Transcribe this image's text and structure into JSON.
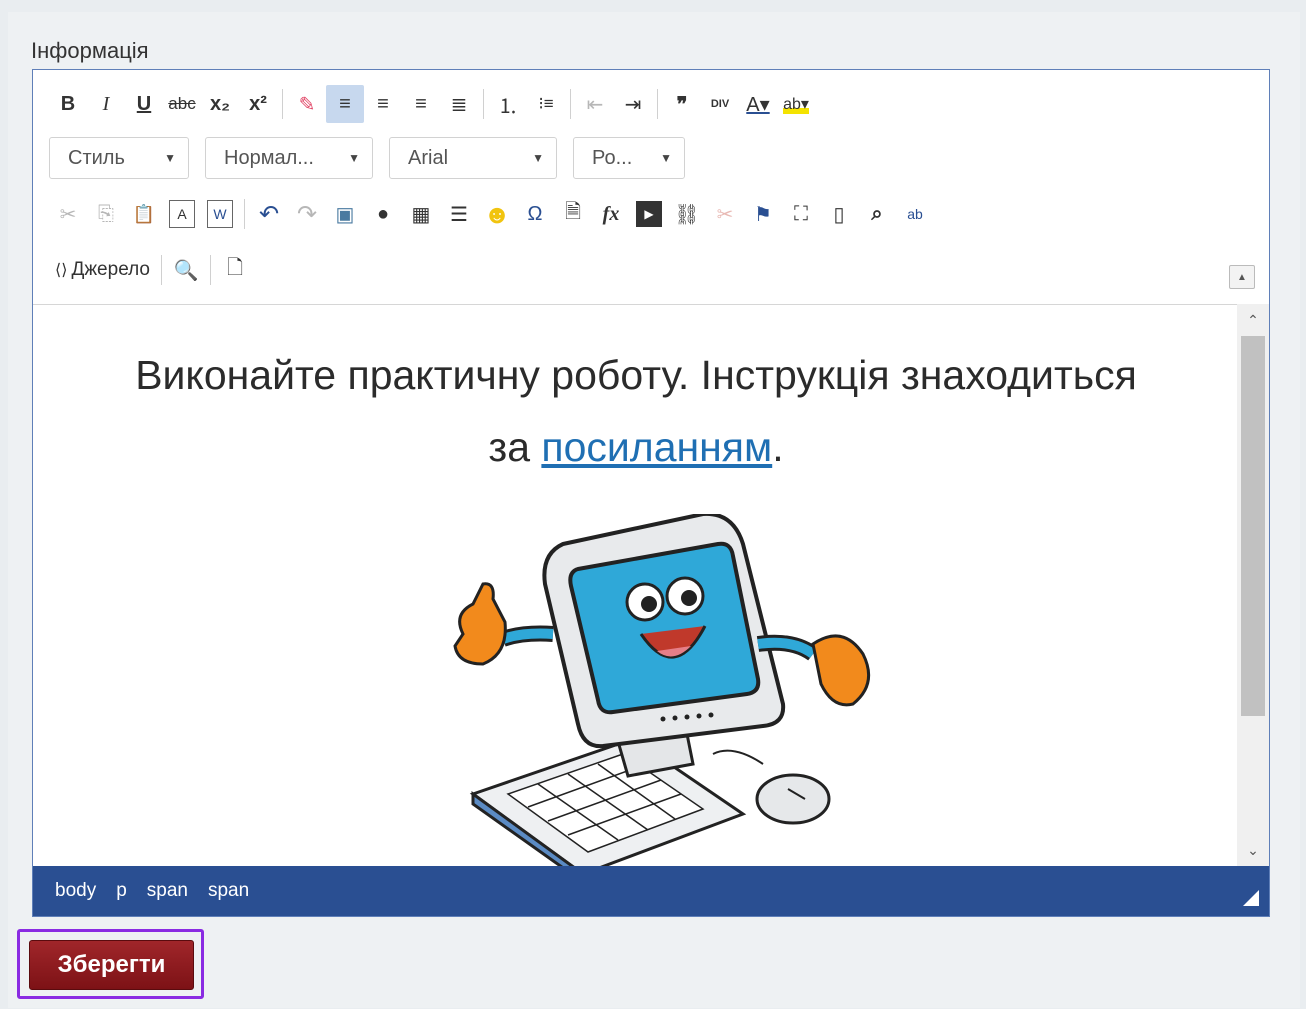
{
  "field": {
    "label": "Інформація"
  },
  "toolbar": {
    "row1": [
      {
        "name": "bold-button",
        "glyph": "B",
        "style": "font-weight:bold"
      },
      {
        "name": "italic-button",
        "glyph": "I",
        "style": "font-style:italic;font-family:'Liberation Serif',serif"
      },
      {
        "name": "underline-button",
        "glyph": "U",
        "style": "text-decoration:underline;font-weight:bold"
      },
      {
        "name": "strikethrough-button",
        "glyph": "abc",
        "style": "text-decoration:line-through;font-size:17px"
      },
      {
        "name": "subscript-button",
        "glyph": "x₂",
        "style": "font-weight:bold"
      },
      {
        "name": "superscript-button",
        "glyph": "x²",
        "style": "font-weight:bold"
      },
      {
        "sep": true
      },
      {
        "name": "remove-format-button",
        "glyph": "✎",
        "style": "color:#e24a6a"
      },
      {
        "name": "align-left-button",
        "glyph": "≡",
        "style": "",
        "active": true
      },
      {
        "name": "align-center-button",
        "glyph": "≡",
        "style": ""
      },
      {
        "name": "align-right-button",
        "glyph": "≡",
        "style": ""
      },
      {
        "name": "align-justify-button",
        "glyph": "≣",
        "style": ""
      },
      {
        "sep": true
      },
      {
        "name": "numbered-list-button",
        "glyph": "⒈",
        "style": ""
      },
      {
        "name": "bulleted-list-button",
        "glyph": "⁝≡",
        "style": "font-size:17px"
      },
      {
        "sep": true
      },
      {
        "name": "outdent-button",
        "glyph": "⇤",
        "style": "",
        "disabled": true
      },
      {
        "name": "indent-button",
        "glyph": "⇥",
        "style": ""
      },
      {
        "sep": true
      },
      {
        "name": "blockquote-button",
        "glyph": "❞",
        "style": "font-weight:bold"
      },
      {
        "name": "div-container-button",
        "glyph": "DIV",
        "style": "font-size:11px;font-weight:bold"
      },
      {
        "name": "text-color-button",
        "glyph": "A▾",
        "style": "text-decoration:underline;text-decoration-color:#2a4f92"
      },
      {
        "name": "background-color-button",
        "glyph": "ab▾",
        "style": "background:linear-gradient(transparent 70%,#f4e300 70%);font-size:16px"
      }
    ],
    "combos": [
      {
        "name": "style-combo",
        "label": "Стиль",
        "width": 140
      },
      {
        "name": "format-combo",
        "label": "Нормал...",
        "width": 168
      },
      {
        "name": "font-combo",
        "label": "Arial",
        "width": 168
      },
      {
        "name": "size-combo",
        "label": "Ро...",
        "width": 112
      }
    ],
    "row3": [
      {
        "name": "cut-button",
        "glyph": "✂",
        "style": "",
        "disabled": true
      },
      {
        "name": "copy-button",
        "glyph": "⎘",
        "style": "",
        "disabled": true
      },
      {
        "name": "paste-button",
        "glyph": "📋",
        "style": "font-size:18px"
      },
      {
        "name": "paste-text-button",
        "glyph": "A",
        "style": "border:1px solid #666;font-size:14px;width:24px;height:26px;margin:6px"
      },
      {
        "name": "paste-word-button",
        "glyph": "W",
        "style": "border:1px solid #666;font-size:14px;width:24px;height:26px;margin:6px;color:#2a4f92"
      },
      {
        "sep": true
      },
      {
        "name": "undo-button",
        "glyph": "↶",
        "style": "color:#2a4f92;font-size:24px"
      },
      {
        "name": "redo-button",
        "glyph": "↷",
        "style": "font-size:24px",
        "disabled": true
      },
      {
        "name": "image-button",
        "glyph": "▣",
        "style": "color:#4a7aa0"
      },
      {
        "name": "flash-button",
        "glyph": "●",
        "style": "color:#333"
      },
      {
        "name": "table-button",
        "glyph": "▦",
        "style": ""
      },
      {
        "name": "horizontal-line-button",
        "glyph": "☰",
        "style": ""
      },
      {
        "name": "smiley-button",
        "glyph": "☻",
        "style": "color:#f1c40f;font-size:26px"
      },
      {
        "name": "special-char-button",
        "glyph": "Ω",
        "style": "color:#2a4f92"
      },
      {
        "name": "iframe-button",
        "glyph": "🗎",
        "style": ""
      },
      {
        "name": "formula-button",
        "glyph": "fx",
        "style": "font-style:italic;font-weight:bold;font-family:'Liberation Serif',serif"
      },
      {
        "name": "youtube-button",
        "glyph": "▶",
        "style": "background:#333;color:#fff;font-size:12px;width:26px;height:26px;margin:6px"
      },
      {
        "name": "link-button",
        "glyph": "⛓",
        "style": ""
      },
      {
        "name": "unlink-button",
        "glyph": "✂",
        "style": "color:#c0392b",
        "disabled": true
      },
      {
        "name": "anchor-button",
        "glyph": "⚑",
        "style": "color:#2a4f92"
      },
      {
        "name": "maximize-button",
        "glyph": "⛶",
        "style": ""
      },
      {
        "name": "show-blocks-button",
        "glyph": "▯",
        "style": ""
      },
      {
        "name": "find-button",
        "glyph": "⌕",
        "style": "font-weight:bold"
      },
      {
        "name": "replace-button",
        "glyph": "ab",
        "style": "font-size:14px;color:#2a4f92"
      }
    ],
    "row4": {
      "source_label": "Джерело",
      "preview_glyph": "🔍",
      "templates_glyph": "🗋"
    },
    "collapse_glyph": "▲"
  },
  "content": {
    "line1": "Виконайте практичну роботу. Інструкція знаходиться",
    "line2_prefix": "за ",
    "link_text": "посиланням",
    "line2_suffix": "."
  },
  "path_bar": [
    "body",
    "p",
    "span",
    "span"
  ],
  "save_button": {
    "label": "Зберегти"
  },
  "colors": {
    "path_bar": "#2a4f92",
    "save_button": "#8e1b1f",
    "highlight_border": "#8a2be2",
    "link": "#1f6fb3"
  }
}
